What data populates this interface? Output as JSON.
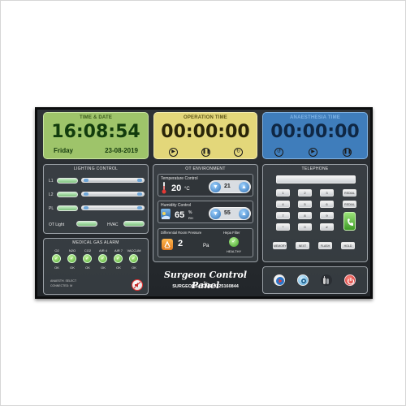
{
  "time_date": {
    "title": "TIME & DATE",
    "time": "16:08:54",
    "day": "Friday",
    "date": "23-08-2019",
    "bg": "#9ec46a"
  },
  "operation_time": {
    "title": "OPERATION TIME",
    "time": "00:00:00",
    "bg": "#e3d77a"
  },
  "anaesthesia_time": {
    "title": "ANAESTHESIA TIME",
    "time": "00:00:00",
    "bg": "#3f7dbb"
  },
  "lighting": {
    "title": "LIGHTING CONTROL",
    "rows": [
      "L1",
      "L2",
      "PL"
    ],
    "ot_light": "OT Light",
    "hvac": "HVAC"
  },
  "environment": {
    "title": "OT ENVIRONMENT",
    "temperature": {
      "label": "Temperature Control",
      "value": "20",
      "unit": "°C",
      "setpoint": "21"
    },
    "humidity": {
      "label": "Humidity Control",
      "value": "65",
      "unit_top": "%",
      "unit_bottom": "RH",
      "setpoint": "55"
    },
    "pressure": {
      "label": "Differential Room Pressure",
      "value": "2",
      "unit": "Pa"
    },
    "hepa": {
      "label": "Hepa Filter",
      "status": "HEALTHY"
    }
  },
  "telephone": {
    "title": "TELEPHONE",
    "keys": [
      "1",
      "2",
      "3",
      "4",
      "5",
      "6",
      "7",
      "8",
      "9",
      "*",
      "0",
      "#"
    ],
    "side_keys": [
      "REDIAL",
      "REDIAL",
      "FLASH"
    ],
    "bottom_keys": [
      "MEMORY",
      "NEXT",
      "FLASH",
      "HOLD"
    ]
  },
  "gas_alarm": {
    "title": "MEDICAL GAS ALARM",
    "gases": [
      "O2",
      "N2O",
      "CO2",
      "AIR 4",
      "AIR 7",
      "VACCUM"
    ],
    "status": "OK",
    "footer_line1": "ANAESTH. SELECT",
    "footer_line2": "CONNECTED: M"
  },
  "brand": {
    "name": "Surgeon Control Panel",
    "by": "By",
    "company": "SURGEONS HOME 9325160844"
  }
}
